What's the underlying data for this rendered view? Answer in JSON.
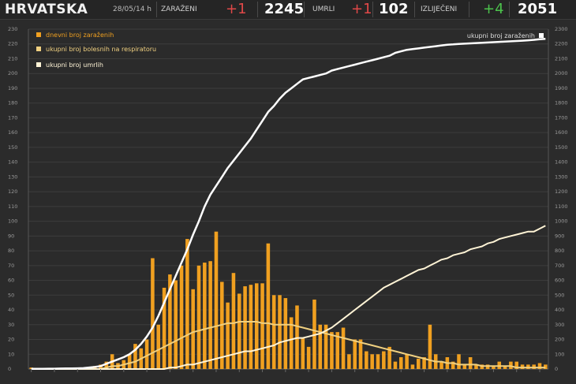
{
  "header": {
    "country": "HRVATSKA",
    "timestamp": "28/05/14 h",
    "infected_label": "ZARAŽENI",
    "infected_delta": "+1",
    "infected_total": "2245",
    "deaths_label": "UMRLI",
    "deaths_delta": "+1",
    "deaths_total": "102",
    "recovered_label": "IZLIJEČENI",
    "recovered_delta": "+4",
    "recovered_total": "2051",
    "colors": {
      "negative": "#e04848",
      "positive": "#4cc24c"
    }
  },
  "chart_data": {
    "type": "bar",
    "legend": [
      {
        "label": "dnevni broj zaraženih",
        "color": "#f0a020"
      },
      {
        "label": "ukupni broj bolesnih na respiratoru",
        "color": "#f0d080"
      },
      {
        "label": "ukupni broj umrlih",
        "color": "#fff4d6"
      }
    ],
    "right_legend": {
      "label": "ukupni broj zaraženih",
      "color": "#ffffff"
    },
    "left_axis": {
      "min": 0,
      "max": 230,
      "step": 10
    },
    "right_axis": {
      "min": 0,
      "max": 2300,
      "step": 100
    },
    "daily_cases": [
      1,
      0,
      0,
      0,
      0,
      0,
      0,
      0,
      0,
      1,
      1,
      2,
      3,
      5,
      10,
      4,
      6,
      10,
      17,
      14,
      20,
      75,
      30,
      55,
      64,
      60,
      70,
      88,
      54,
      70,
      72,
      73,
      93,
      59,
      45,
      65,
      51,
      56,
      57,
      58,
      58,
      85,
      50,
      50,
      48,
      35,
      43,
      21,
      15,
      47,
      30,
      30,
      25,
      25,
      28,
      10,
      20,
      20,
      12,
      10,
      10,
      12,
      15,
      5,
      8,
      10,
      3,
      7,
      8,
      30,
      10,
      5,
      8,
      5,
      10,
      3,
      8,
      3,
      3,
      3,
      2,
      5,
      2,
      5,
      5,
      3,
      3,
      3,
      4,
      3
    ],
    "cumulative_cases": [
      1,
      1,
      1,
      2,
      2,
      3,
      4,
      4,
      5,
      6,
      10,
      14,
      20,
      35,
      50,
      65,
      80,
      100,
      130,
      170,
      220,
      280,
      360,
      450,
      540,
      630,
      720,
      810,
      910,
      1000,
      1100,
      1180,
      1240,
      1300,
      1360,
      1410,
      1460,
      1510,
      1560,
      1620,
      1680,
      1740,
      1780,
      1830,
      1870,
      1900,
      1930,
      1960,
      1970,
      1980,
      1990,
      2000,
      2020,
      2030,
      2040,
      2050,
      2060,
      2070,
      2080,
      2090,
      2100,
      2110,
      2120,
      2140,
      2150,
      2160,
      2165,
      2170,
      2175,
      2180,
      2185,
      2190,
      2195,
      2197,
      2200,
      2202,
      2204,
      2206,
      2208,
      2210,
      2212,
      2214,
      2216,
      2218,
      2220,
      2222,
      2225,
      2228,
      2232,
      2235
    ],
    "respirator_cumulative": [
      0,
      0,
      0,
      0,
      0,
      0,
      0,
      0,
      0,
      0,
      0,
      0,
      0,
      1,
      2,
      2,
      3,
      4,
      5,
      7,
      9,
      11,
      13,
      15,
      17,
      19,
      21,
      23,
      25,
      26,
      27,
      28,
      29,
      30,
      31,
      31,
      32,
      32,
      32,
      32,
      31,
      31,
      30,
      30,
      30,
      30,
      29,
      28,
      27,
      26,
      25,
      24,
      23,
      22,
      21,
      20,
      19,
      18,
      17,
      16,
      15,
      14,
      13,
      12,
      11,
      10,
      9,
      8,
      7,
      6,
      5,
      5,
      4,
      4,
      3,
      3,
      3,
      3,
      2,
      2,
      2,
      2,
      2,
      2,
      1,
      1,
      1,
      1,
      1,
      1
    ],
    "deaths_cumulative": [
      0,
      0,
      0,
      0,
      0,
      0,
      0,
      0,
      0,
      0,
      0,
      0,
      0,
      0,
      0,
      0,
      0,
      0,
      0,
      0,
      0,
      0,
      0,
      0,
      1,
      1,
      2,
      3,
      3,
      4,
      5,
      6,
      7,
      8,
      9,
      10,
      11,
      12,
      12,
      13,
      14,
      15,
      16,
      18,
      19,
      20,
      21,
      21,
      22,
      23,
      24,
      26,
      28,
      31,
      34,
      37,
      40,
      43,
      46,
      49,
      52,
      55,
      57,
      59,
      61,
      63,
      65,
      67,
      68,
      70,
      72,
      74,
      75,
      77,
      78,
      79,
      81,
      82,
      83,
      85,
      86,
      88,
      89,
      90,
      91,
      92,
      93,
      93,
      95,
      97
    ]
  }
}
